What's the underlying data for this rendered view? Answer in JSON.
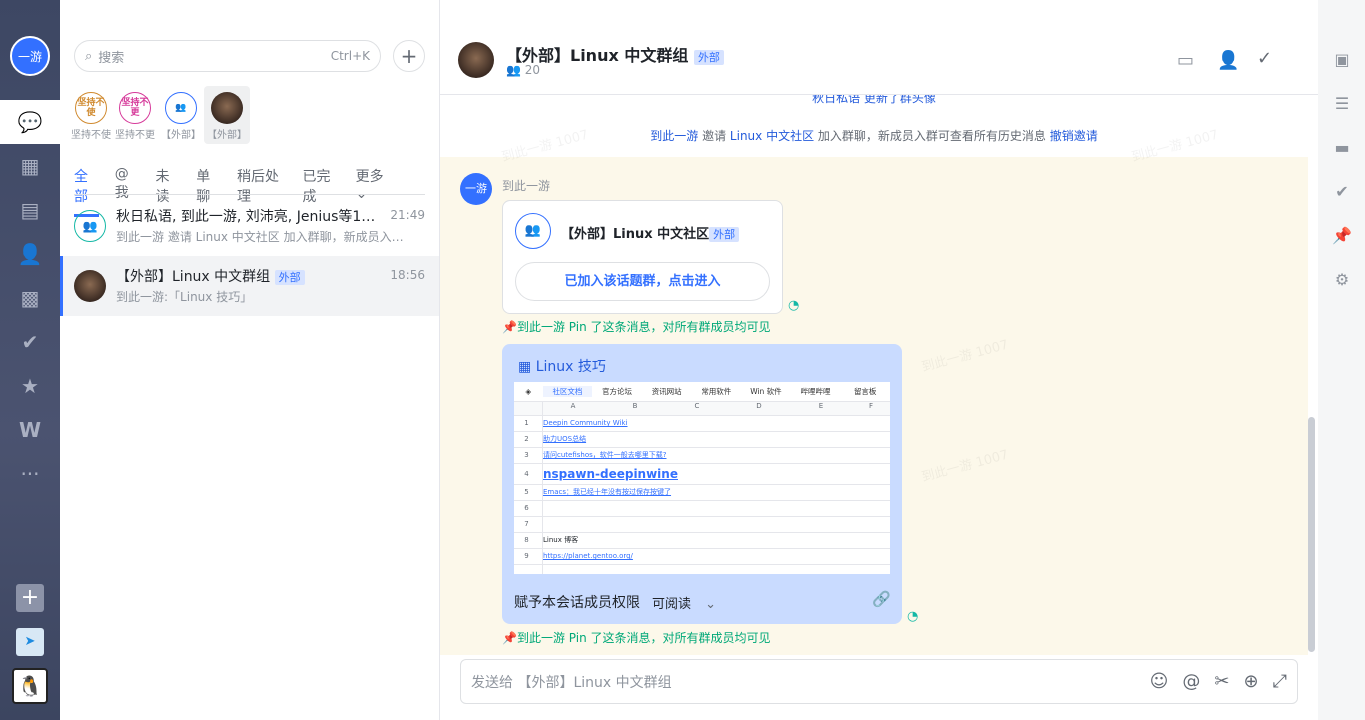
{
  "window": {
    "minimize": "—",
    "restore": "❐",
    "close": "✕"
  },
  "nav": {
    "me": "一游",
    "items": [
      "chat",
      "calendar",
      "docs",
      "contacts",
      "workplace",
      "approval",
      "favorites",
      "wiki",
      "more"
    ],
    "add": "+"
  },
  "list": {
    "search_placeholder": "搜索",
    "search_shortcut": "Ctrl+K",
    "pinned": [
      {
        "avatar": "坚持不使",
        "label": "坚持不使",
        "color": "#d08a2f"
      },
      {
        "avatar": "坚持不更",
        "label": "坚持不更",
        "color": "#d63a9a"
      },
      {
        "avatar": "",
        "label": "【外部】",
        "color": "#3370ff"
      },
      {
        "avatar": "",
        "label": "【外部】",
        "color": ""
      }
    ],
    "tabs": [
      "全部",
      "@我",
      "未读",
      "单聊",
      "稍后处理",
      "已完成",
      "更多"
    ],
    "conversations": [
      {
        "title": "秋日私语, 到此一游, 刘沛亮, Jenius等1…",
        "time": "21:49",
        "preview": "到此一游 邀请 Linux 中文社区 加入群聊，新成员入…"
      },
      {
        "title": "【外部】Linux 中文群组",
        "tag": "外部",
        "time": "18:56",
        "preview": "到此一游:「Linux 技巧」"
      }
    ]
  },
  "chat": {
    "title": "【外部】Linux 中文群组",
    "tag": "外部",
    "members": "20",
    "top_partial": "秋日私语 更新了群头像",
    "sys": {
      "actor": "到此一游",
      "verb": " 邀请 ",
      "target": "Linux 中文社区",
      "rest": " 加入群聊，新成员入群可查看所有历史消息 ",
      "action": "撤销邀请"
    },
    "sender": "到此一游",
    "sender_avatar": "一游",
    "card": {
      "title": "【外部】Linux 中文社区",
      "tag": "外部",
      "button": "已加入该话题群，点击进入"
    },
    "pin_note": "到此一游 Pin 了这条消息，对所有群成员均可见",
    "doc": {
      "title": "Linux 技巧",
      "sheet_tabs": [
        "社区文档",
        "官方论坛",
        "资讯网站",
        "常用软件",
        "Win 软件",
        "哔哩哔哩",
        "留言板"
      ],
      "columns": [
        "A",
        "B",
        "C",
        "D",
        "E",
        "F"
      ],
      "rows": [
        {
          "n": "1",
          "v": "Deepin Community Wiki"
        },
        {
          "n": "2",
          "v": "助力UOS总结"
        },
        {
          "n": "3",
          "v": "请问cutefishos，软件一般去哪里下载?"
        },
        {
          "n": "4",
          "v": "nspawn-deepinwine"
        },
        {
          "n": "5",
          "v": "Emacs：我已经十年没有按过保存按键了"
        },
        {
          "n": "6",
          "v": ""
        },
        {
          "n": "7",
          "v": ""
        },
        {
          "n": "8",
          "v": "Linux 博客"
        },
        {
          "n": "9",
          "v": "https://planet.gentoo.org/"
        }
      ],
      "perm_label": "赋予本会话成员权限",
      "perm_value": "可阅读"
    },
    "input_placeholder": "发送给 【外部】Linux 中文群组",
    "watermark": "到此一游 1007"
  }
}
